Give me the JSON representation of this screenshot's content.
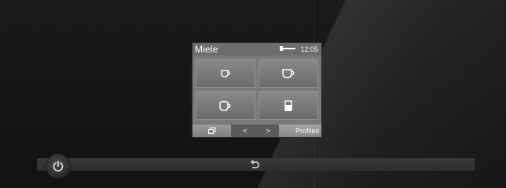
{
  "screen": {
    "brand": "Miele",
    "time": "12:05",
    "tiles": [
      {
        "icon": "espresso-cup-icon"
      },
      {
        "icon": "coffee-cup-icon"
      },
      {
        "icon": "cappuccino-cup-icon"
      },
      {
        "icon": "latte-glass-icon"
      }
    ],
    "bottom_bar": {
      "cups_icon": "cups-icon",
      "prev_label": "<",
      "next_label": ">",
      "profiles_label": "Profiles"
    }
  },
  "controls": {
    "power_icon": "power-icon",
    "back_icon": "back-arrow-icon"
  },
  "colors": {
    "panel_background": "#121212",
    "screen_background": "#7a7a7a",
    "tile_background": "#7d7d7d",
    "icon_color": "#ffffff"
  }
}
